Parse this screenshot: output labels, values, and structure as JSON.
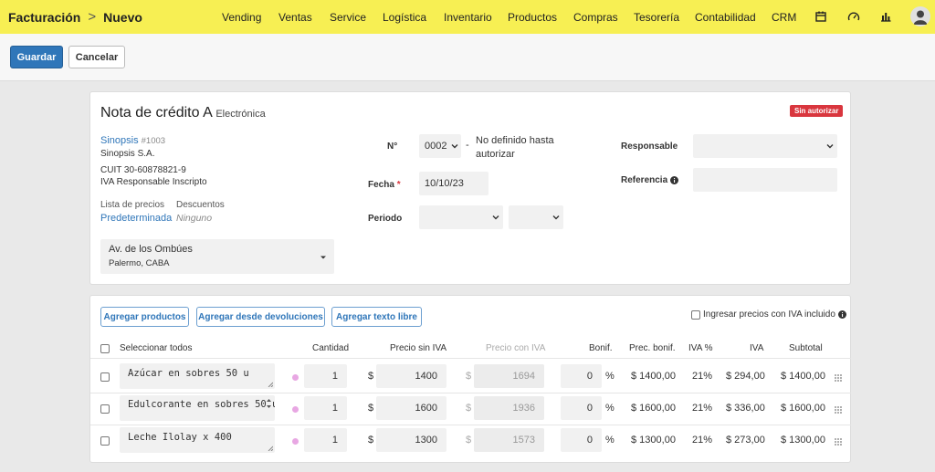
{
  "topbar": {
    "module": "Facturación",
    "separator": ">",
    "page": "Nuevo",
    "nav": [
      "Vending",
      "Ventas",
      "Service",
      "Logística",
      "Inventario",
      "Productos",
      "Compras",
      "Tesorería",
      "Contabilidad",
      "CRM"
    ],
    "icons": [
      "calendar-icon",
      "gauge-icon",
      "bar-chart-icon",
      "user-avatar-icon"
    ]
  },
  "actions": {
    "save": "Guardar",
    "cancel": "Cancelar"
  },
  "doc": {
    "title": "Nota de crédito A",
    "subtitle": "Electrónica",
    "status": "Sin autorizar",
    "client": {
      "name": "Sinopsis",
      "code": "#1003",
      "company": "Sinopsis S.A.",
      "cuit": "CUIT 30-60878821-9",
      "iva": "IVA Responsable Inscripto"
    },
    "price_list_label": "Lista de precios",
    "price_list_value": "Predeterminada",
    "discounts_label": "Descuentos",
    "discounts_value": "Ninguno",
    "address_line1": "Av. de los Ombúes",
    "address_line2": "Palermo, CABA",
    "number_label": "N°",
    "number_prefix": "0002",
    "number_dash": "-",
    "number_value": "No definido hasta autorizar",
    "date_label": "Fecha",
    "date_required": "*",
    "date_value": "10/10/23",
    "period_label": "Periodo",
    "responsible_label": "Responsable",
    "reference_label": "Referencia"
  },
  "items": {
    "buttons": {
      "add_products": "Agregar productos",
      "add_returns": "Agregar desde devoluciones",
      "add_text": "Agregar texto libre"
    },
    "iva_included_label": "Ingresar precios con IVA incluido",
    "headers": {
      "select_all": "Seleccionar todos",
      "quantity": "Cantidad",
      "price_no_iva": "Precio sin IVA",
      "price_with_iva": "Precio con IVA",
      "discount": "Bonif.",
      "discounted_price": "Prec. bonif.",
      "iva_pct": "IVA %",
      "iva": "IVA",
      "subtotal": "Subtotal"
    },
    "currency": "$",
    "percent": "%",
    "rows": [
      {
        "description": "Azúcar en sobres 50 u",
        "qty": "1",
        "price": "1400",
        "price_iva": "1694",
        "discount": "0",
        "disc_price": "$ 1400,00",
        "iva_pct": "21%",
        "iva": "$ 294,00",
        "subtotal": "$ 1400,00"
      },
      {
        "description": "Edulcorante en sobres 50 u",
        "qty": "1",
        "price": "1600",
        "price_iva": "1936",
        "discount": "0",
        "disc_price": "$ 1600,00",
        "iva_pct": "21%",
        "iva": "$ 336,00",
        "subtotal": "$ 1600,00"
      },
      {
        "description": "Leche Ilolay x 400",
        "qty": "1",
        "price": "1300",
        "price_iva": "1573",
        "discount": "0",
        "disc_price": "$ 1300,00",
        "iva_pct": "21%",
        "iva": "$ 273,00",
        "subtotal": "$ 1300,00"
      }
    ]
  }
}
